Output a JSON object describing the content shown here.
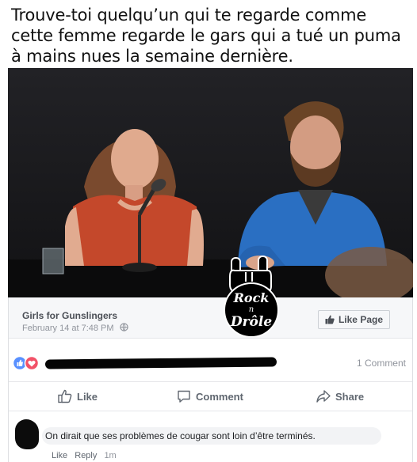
{
  "meme": {
    "caption": "Trouve-toi quelqu’un qui te regarde comme cette femme regarde le gars qui a tué un puma à mains nues la semaine dernière."
  },
  "watermark": {
    "line1": "Rock",
    "line2": "n",
    "line3": "Drôle"
  },
  "post": {
    "page_name": "Girls for Gunslingers",
    "date": "February 14 at 7:48 PM",
    "like_page_label": "Like Page",
    "comment_count": "1 Comment",
    "actions": {
      "like": "Like",
      "comment": "Comment",
      "share": "Share"
    }
  },
  "comment": {
    "text": "On dirait que ses problèmes de cougar sont loin d’être terminés.",
    "like": "Like",
    "reply": "Reply",
    "time": "1m"
  },
  "colors": {
    "facebook_blue": "#4267b2",
    "reaction_like": "#5890ff",
    "reaction_love": "#f25268",
    "jacket_blue": "#2a6fc2",
    "dress_red": "#c4482b"
  }
}
